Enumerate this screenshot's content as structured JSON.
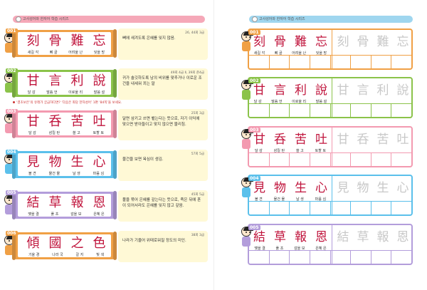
{
  "left_page": {
    "tab_label": "고사성어와 한자어 학습 시리즈",
    "tab_color": "#f5a8b8",
    "note": "‘결초보은’의 유래가 궁금하다면? ‘다음은 죄당 한자성어’ 1편 ‘84쪽’을 보세요.",
    "entries": [
      {
        "num": "001",
        "color": "#f0a045",
        "hanja": [
          "刻",
          "骨",
          "難",
          "忘"
        ],
        "reads": [
          "새길 각",
          "뼈 골",
          "어려울 난",
          "잊을 망"
        ],
        "source": "26, 44회 3급",
        "meaning": "뼈에 새겨도록 은혜를 잊지 않음."
      },
      {
        "num": "002",
        "color": "#8bc34a",
        "hanja": [
          "甘",
          "言",
          "利",
          "說"
        ],
        "reads": [
          "달 감",
          "말씀 언",
          "이로울 리",
          "말씀 설"
        ],
        "source": "49회 4급 Ⅱ, 39회 준4급",
        "meaning": "귀가 솔깃하도록 남의 비위를 맞추거나 이로운 조건을 내세워 꾀는 말"
      },
      {
        "num": "003",
        "color": "#f39ab0",
        "hanja": [
          "甘",
          "呑",
          "苦",
          "吐"
        ],
        "reads": [
          "달 감",
          "삼킬 탄",
          "쓸 고",
          "토할 토"
        ],
        "source": "25회 3급",
        "meaning": "달면 삼키고 쓰면 뱉는다는 뜻으로, 자기 이익에 맞으면 받아들이고 맞지 않으면 물리침."
      },
      {
        "num": "004",
        "color": "#5bc0eb",
        "hanja": [
          "見",
          "物",
          "生",
          "心"
        ],
        "reads": [
          "볼 견",
          "물건 물",
          "날 생",
          "마음 심"
        ],
        "source": "57회 5급",
        "meaning": "물건을 보면 욕심이 생김."
      },
      {
        "num": "005",
        "color": "#b39ddb",
        "hanja": [
          "結",
          "草",
          "報",
          "恩"
        ],
        "reads": [
          "맺을 결",
          "풀 초",
          "갚을 보",
          "은혜 은"
        ],
        "source": "45회 5급",
        "meaning": "풀을 묶어 은혜를 갚는다는 뜻으로, 죽은 뒤에 혼이 되어서라도 은혜를 잊지 않고 갚음."
      },
      {
        "num": "006",
        "color": "#f0a045",
        "hanja": [
          "傾",
          "國",
          "之",
          "色"
        ],
        "reads": [
          "기울 경",
          "나라 국",
          "갈 지",
          "빛 색"
        ],
        "source": "38회 3급",
        "meaning": "나라가 기울어 위태로워질 정도의 미인."
      }
    ]
  },
  "right_page": {
    "tab_label": "고사성어와 한자어 학습 시리즈",
    "tab_color": "#9fd6ef",
    "practice": [
      {
        "num": "001",
        "color": "#f0a045",
        "hanja": [
          "刻",
          "骨",
          "難",
          "忘"
        ],
        "reads": [
          "새길 각",
          "뼈 골",
          "어려울 난",
          "잊을 망"
        ]
      },
      {
        "num": "002",
        "color": "#8bc34a",
        "hanja": [
          "甘",
          "言",
          "利",
          "說"
        ],
        "reads": [
          "달 감",
          "말씀 언",
          "이로울 리",
          "말씀 설"
        ]
      },
      {
        "num": "003",
        "color": "#f39ab0",
        "hanja": [
          "甘",
          "呑",
          "苦",
          "吐"
        ],
        "reads": [
          "달 감",
          "삼킬 탄",
          "쓸 고",
          "토할 토"
        ]
      },
      {
        "num": "004",
        "color": "#5bc0eb",
        "hanja": [
          "見",
          "物",
          "生",
          "心"
        ],
        "reads": [
          "볼 견",
          "물건 물",
          "날 생",
          "마음 심"
        ]
      },
      {
        "num": "005",
        "color": "#b39ddb",
        "hanja": [
          "結",
          "草",
          "報",
          "恩"
        ],
        "reads": [
          "맺을 결",
          "풀 초",
          "갚을 보",
          "은혜 은"
        ]
      }
    ]
  }
}
